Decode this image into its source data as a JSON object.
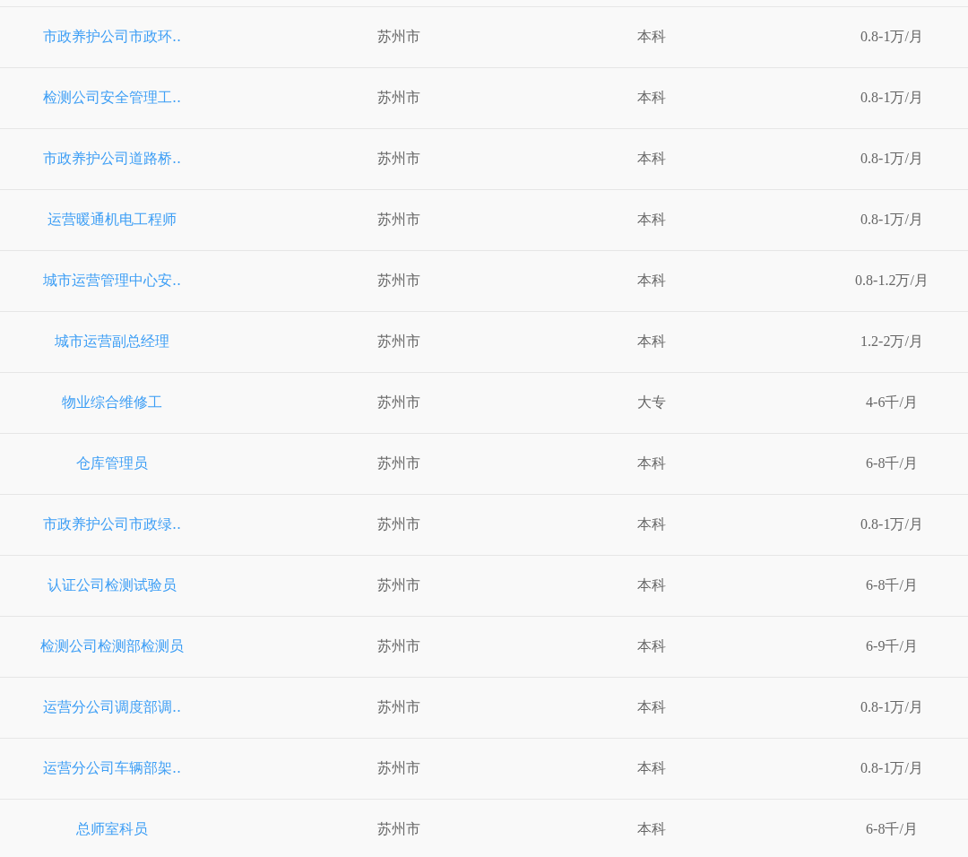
{
  "rows": [
    {
      "title": "市政养护公司市政环..",
      "city": "苏州市",
      "education": "本科",
      "salary": "0.8-1万/月"
    },
    {
      "title": "检测公司安全管理工..",
      "city": "苏州市",
      "education": "本科",
      "salary": "0.8-1万/月"
    },
    {
      "title": "市政养护公司道路桥..",
      "city": "苏州市",
      "education": "本科",
      "salary": "0.8-1万/月"
    },
    {
      "title": "运营暖通机电工程师",
      "city": "苏州市",
      "education": "本科",
      "salary": "0.8-1万/月"
    },
    {
      "title": "城市运营管理中心安..",
      "city": "苏州市",
      "education": "本科",
      "salary": "0.8-1.2万/月"
    },
    {
      "title": "城市运营副总经理",
      "city": "苏州市",
      "education": "本科",
      "salary": "1.2-2万/月"
    },
    {
      "title": "物业综合维修工",
      "city": "苏州市",
      "education": "大专",
      "salary": "4-6千/月"
    },
    {
      "title": "仓库管理员",
      "city": "苏州市",
      "education": "本科",
      "salary": "6-8千/月"
    },
    {
      "title": "市政养护公司市政绿..",
      "city": "苏州市",
      "education": "本科",
      "salary": "0.8-1万/月"
    },
    {
      "title": "认证公司检测试验员",
      "city": "苏州市",
      "education": "本科",
      "salary": "6-8千/月"
    },
    {
      "title": "检测公司检测部检测员",
      "city": "苏州市",
      "education": "本科",
      "salary": "6-9千/月"
    },
    {
      "title": "运营分公司调度部调..",
      "city": "苏州市",
      "education": "本科",
      "salary": "0.8-1万/月"
    },
    {
      "title": "运营分公司车辆部架..",
      "city": "苏州市",
      "education": "本科",
      "salary": "0.8-1万/月"
    },
    {
      "title": "总师室科员",
      "city": "苏州市",
      "education": "本科",
      "salary": "6-8千/月"
    }
  ]
}
